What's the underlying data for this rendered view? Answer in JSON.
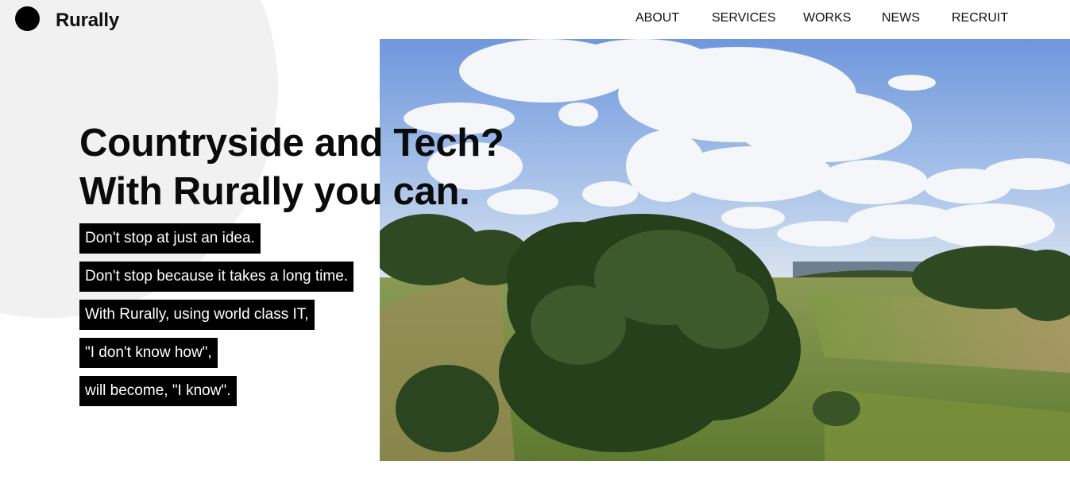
{
  "header": {
    "brand": "Rurally",
    "nav": [
      "ABOUT",
      "SERVICES",
      "WORKS",
      "NEWS",
      "RECRUIT"
    ]
  },
  "hero": {
    "headline": [
      "Countryside and Tech?",
      "With Rurally you can."
    ],
    "taglines": [
      "Don't stop at just an idea.",
      "Don't stop because it takes a long time.",
      "With Rurally, using world class IT,",
      "\"I don't know how\",",
      "will become, \"I know\"."
    ]
  },
  "colors": {
    "accent": "#000000",
    "circle": "#f1f1f1",
    "sky": "#7fa6e0"
  }
}
